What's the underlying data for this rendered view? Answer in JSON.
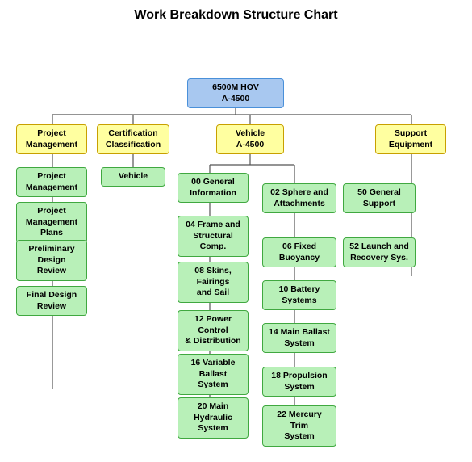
{
  "title": "Work Breakdown Structure Chart",
  "nodes": {
    "root": {
      "label": "6500M HOV\nA-4500"
    },
    "level1": [
      {
        "label": "Project\nManagement"
      },
      {
        "label": "Certification\nClassification"
      },
      {
        "label": "Vehicle\nA-4500"
      },
      {
        "label": "Support\nEquipment"
      }
    ],
    "pm_children": [
      {
        "label": "Project\nManagement"
      },
      {
        "label": "Project\nManagement\nPlans"
      },
      {
        "label": "Preliminary\nDesign\nReview"
      },
      {
        "label": "Final Design\nReview"
      }
    ],
    "cert_children": [
      {
        "label": "Vehicle"
      }
    ],
    "vehicle_left": [
      {
        "label": "00 General\nInformation"
      },
      {
        "label": "04 Frame and\nStructural\nComp."
      },
      {
        "label": "08 Skins,\nFairings\nand Sail"
      },
      {
        "label": "12 Power\nControl\n& Distribution"
      },
      {
        "label": "16 Variable\nBallast\nSystem"
      },
      {
        "label": "20 Main\nHydraulic\nSystem"
      }
    ],
    "vehicle_right": [
      {
        "label": "02 Sphere and\nAttachments"
      },
      {
        "label": "06 Fixed\nBuoyancy"
      },
      {
        "label": "10 Battery\nSystems"
      },
      {
        "label": "14 Main Ballast\nSystem"
      },
      {
        "label": "18 Propulsion\nSystem"
      },
      {
        "label": "22 Mercury Trim\nSystem"
      }
    ],
    "support_children": [
      {
        "label": "50 General\nSupport"
      },
      {
        "label": "52 Launch and\nRecovery Sys."
      }
    ]
  }
}
